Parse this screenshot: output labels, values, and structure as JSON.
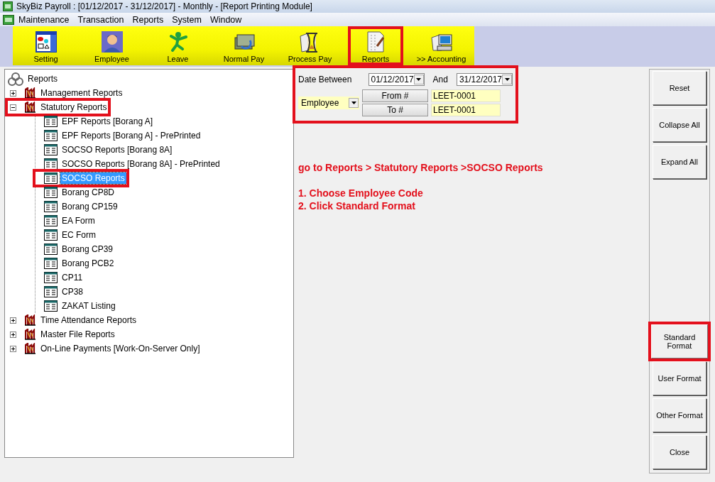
{
  "window": {
    "title": "SkyBiz Payroll : [01/12/2017 - 31/12/2017] - Monthly - [Report Printing Module]"
  },
  "menu": [
    "Maintenance",
    "Transaction",
    "Reports",
    "System",
    "Window"
  ],
  "toolbar": [
    {
      "label": "Setting",
      "highlighted": false
    },
    {
      "label": "Employee",
      "highlighted": false
    },
    {
      "label": "Leave",
      "highlighted": false
    },
    {
      "label": "Normal Pay",
      "highlighted": false
    },
    {
      "label": "Process Pay",
      "highlighted": false
    },
    {
      "label": "Reports",
      "highlighted": true
    },
    {
      "label": ">> Accounting",
      "highlighted": false
    }
  ],
  "tree": {
    "root": "Reports",
    "items": [
      {
        "label": "Management Reports",
        "expanded": false,
        "selected": false,
        "highlighted": false
      },
      {
        "label": "Statutory Reports",
        "expanded": true,
        "selected": false,
        "highlighted": true,
        "children": [
          {
            "label": "EPF Reports [Borang A]",
            "selected": false,
            "highlighted": false
          },
          {
            "label": "EPF Reports [Borang A] - PrePrinted",
            "selected": false,
            "highlighted": false
          },
          {
            "label": "SOCSO Reports [Borang 8A]",
            "selected": false,
            "highlighted": false
          },
          {
            "label": "SOCSO Reports [Borang 8A] - PrePrinted",
            "selected": false,
            "highlighted": false
          },
          {
            "label": "SOCSO Reports",
            "selected": true,
            "highlighted": true
          },
          {
            "label": "Borang CP8D",
            "selected": false,
            "highlighted": false
          },
          {
            "label": "Borang CP159",
            "selected": false,
            "highlighted": false
          },
          {
            "label": "EA Form",
            "selected": false,
            "highlighted": false
          },
          {
            "label": "EC Form",
            "selected": false,
            "highlighted": false
          },
          {
            "label": "Borang CP39",
            "selected": false,
            "highlighted": false
          },
          {
            "label": "Borang PCB2",
            "selected": false,
            "highlighted": false
          },
          {
            "label": "CP11",
            "selected": false,
            "highlighted": false
          },
          {
            "label": "CP38",
            "selected": false,
            "highlighted": false
          },
          {
            "label": "ZAKAT Listing",
            "selected": false,
            "highlighted": false
          }
        ]
      },
      {
        "label": "Time Attendance Reports",
        "expanded": false,
        "selected": false,
        "highlighted": false
      },
      {
        "label": "Master File Reports",
        "expanded": false,
        "selected": false,
        "highlighted": false
      },
      {
        "label": "On-Line Payments [Work-On-Server Only]",
        "expanded": false,
        "selected": false,
        "highlighted": false
      }
    ]
  },
  "filter": {
    "highlighted": true,
    "date_label": "Date Between",
    "date_from": "01/12/2017",
    "and_label": "And",
    "date_to": "31/12/2017",
    "range_type": "Employee",
    "from_button": "From #",
    "from_value": "LEET-0001",
    "to_button": "To #",
    "to_value": "LEET-0001"
  },
  "instructions": [
    "go to Reports > Statutory Reports >SOCSO Reports",
    "1. Choose Employee Code",
    "2. Click Standard Format"
  ],
  "buttons_top": [
    {
      "label": "Reset",
      "highlighted": false
    },
    {
      "label": "Collapse All",
      "highlighted": false
    },
    {
      "label": "Expand All",
      "highlighted": false
    }
  ],
  "buttons_bottom": [
    {
      "label": "Standard Format",
      "highlighted": true
    },
    {
      "label": "User Format",
      "highlighted": false
    },
    {
      "label": "Other Format",
      "highlighted": false
    },
    {
      "label": "Close",
      "highlighted": false
    }
  ]
}
